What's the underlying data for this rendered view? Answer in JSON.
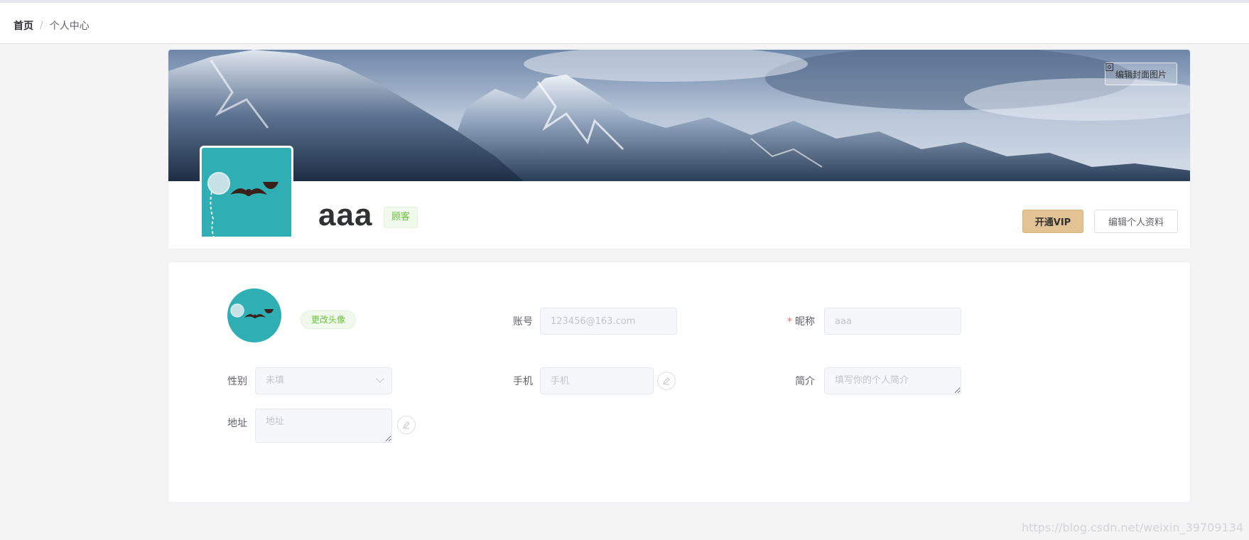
{
  "breadcrumb": {
    "home": "首页",
    "separator": "/",
    "current": "个人中心"
  },
  "profile": {
    "edit_cover_label": "编辑封面图片",
    "username": "aaa",
    "role_tag": "顾客",
    "vip_button": "开通VIP",
    "edit_profile_button": "编辑个人资料",
    "avatar_color": "#2fafb4"
  },
  "form": {
    "change_avatar": "更改头像",
    "account": {
      "label": "账号",
      "value": "123456@163.com"
    },
    "nickname": {
      "label": "昵称",
      "required_mark": "*",
      "value": "aaa"
    },
    "gender": {
      "label": "性别",
      "value": "未填"
    },
    "phone": {
      "label": "手机",
      "placeholder": "手机"
    },
    "bio": {
      "label": "简介",
      "placeholder": "填写你的个人简介"
    },
    "address": {
      "label": "地址",
      "placeholder": "地址"
    }
  },
  "watermark": "https://blog.csdn.net/weixin_39709134",
  "colors": {
    "accent_green": "#67c23a",
    "vip_gold": "#e3c293",
    "required_red": "#f56c6c"
  }
}
